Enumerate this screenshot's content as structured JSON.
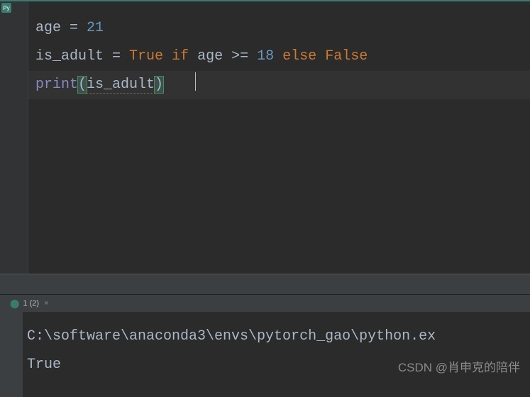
{
  "code": {
    "line1": {
      "var": "age",
      "op": " = ",
      "num": "21"
    },
    "line2": {
      "var1": "is_adult",
      "op1": " = ",
      "bool1": "True",
      "sp1": " ",
      "kw1": "if",
      "sp2": " ",
      "var2": "age",
      "op2": " >= ",
      "num": "18",
      "sp3": " ",
      "kw2": "else",
      "sp4": " ",
      "bool2": "False"
    },
    "line3": {
      "func": "print",
      "paren1": "(",
      "arg": "is_adult",
      "paren2": ")"
    }
  },
  "run_tab": {
    "label": "1 (2)"
  },
  "console": {
    "line1": "C:\\software\\anaconda3\\envs\\pytorch_gao\\python.ex",
    "line2": "True"
  },
  "watermark": "CSDN @肖申克的陪伴",
  "file_badge": "Py"
}
